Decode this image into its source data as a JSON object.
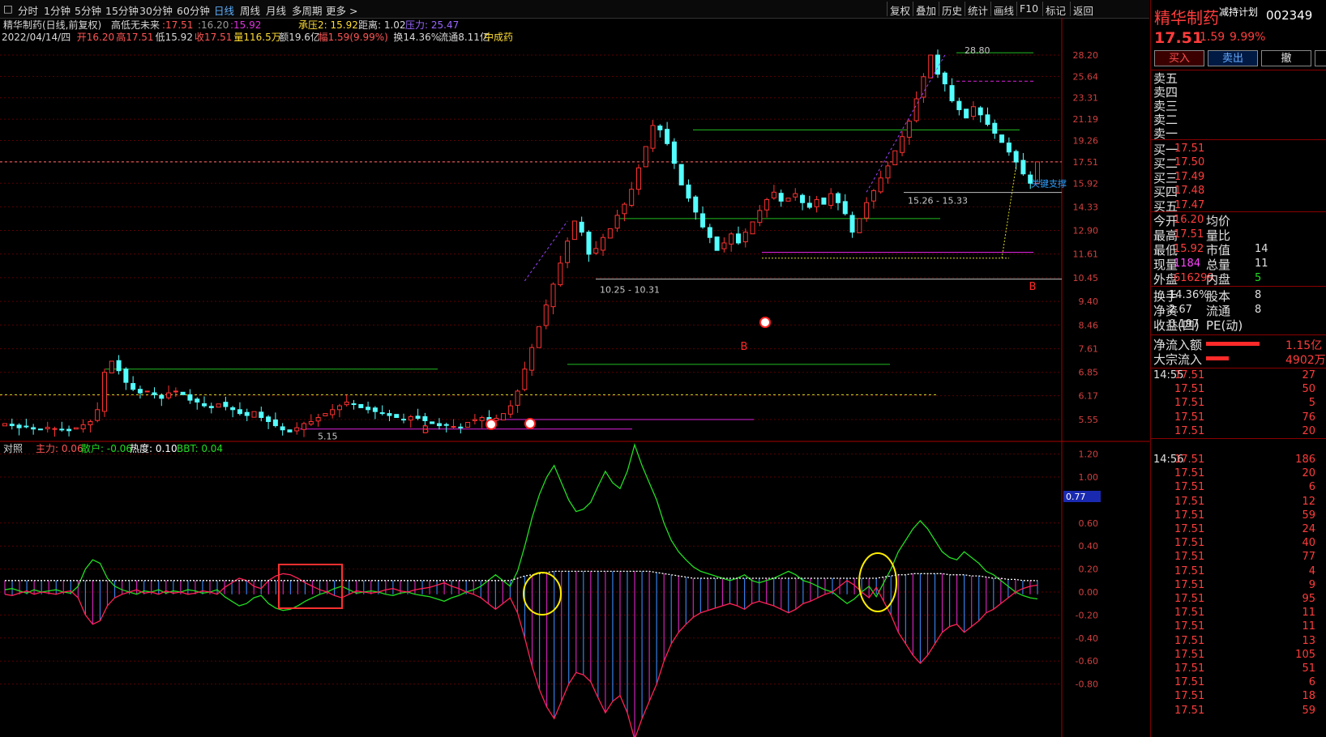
{
  "toolbar": {
    "periods": [
      "分时",
      "1分钟",
      "5分钟",
      "15分钟",
      "30分钟",
      "60分钟",
      "日线",
      "周线",
      "月线",
      "多周期",
      "更多 >"
    ],
    "active": "日线",
    "right": [
      "复权",
      "叠加",
      "历史",
      "统计",
      "画线",
      "F10",
      "标记",
      "返回"
    ]
  },
  "header": {
    "title": "精华制药(日线,前复权)",
    "indicator_name": "高低无未来",
    "indicator_values": [
      ":17.51",
      ":16.20",
      ":15.92"
    ],
    "pressure_label": "承压2: 15.92",
    "distance_label": "距离: 1.02",
    "resist_label": "压力: 25.47",
    "date": "2022/04/14/四",
    "open": "开16.20",
    "high": "高17.51",
    "low": "低15.92",
    "close": "收17.51",
    "volume": "量116.5万",
    "amount": "额19.6亿",
    "change": "幅1.59(9.99%)",
    "turnover": "换14.36%",
    "float": "流通8.11亿",
    "industry": "中成药"
  },
  "lower_header": {
    "name": "对照",
    "main": "主力: 0.06",
    "retail": "散户: -0.06",
    "heat": "热度: 0.10",
    "bbt": "BBT: 0.04"
  },
  "annotations": {
    "peak": "28.80",
    "low_mark": "5.15",
    "zone1": "10.25 - 10.31",
    "zone2": "15.26 - 15.33",
    "key_support": "关键支撑",
    "buy_marker": "B",
    "current_box": "0.77"
  },
  "side": {
    "name": "精华制药",
    "tag": "减持计划",
    "code": "002349",
    "price": "17.51",
    "change": "1.59",
    "pct": "9.99%",
    "buttons": [
      "买入",
      "卖出",
      "撤",
      ""
    ],
    "sells": [
      "卖五",
      "卖四",
      "卖三",
      "卖二",
      "卖一"
    ],
    "buys": [
      {
        "label": "买一",
        "price": "17.51"
      },
      {
        "label": "买二",
        "price": "17.50"
      },
      {
        "label": "买三",
        "price": "17.49"
      },
      {
        "label": "买四",
        "price": "17.48"
      },
      {
        "label": "买五",
        "price": "17.47"
      }
    ],
    "stats": [
      {
        "l1": "今开",
        "v1": "16.20",
        "l2": "均价",
        "v2": ""
      },
      {
        "l1": "最高",
        "v1": "17.51",
        "l2": "量比",
        "v2": ""
      },
      {
        "l1": "最低",
        "v1": "15.92",
        "l2": "市值",
        "v2": "14"
      },
      {
        "l1": "现量",
        "v1": "1184",
        "l2": "总量",
        "v2": "11"
      },
      {
        "l1": "外盘",
        "v1": "616299",
        "l2": "内盘",
        "v2": "5"
      }
    ],
    "stats2": [
      {
        "l1": "换手",
        "v1": "14.36%",
        "l2": "股本",
        "v2": "8"
      },
      {
        "l1": "净资",
        "v1": "2.67",
        "l2": "流通",
        "v2": "8"
      },
      {
        "l1": "收益(四)",
        "v1": "0.197",
        "l2": "PE(动)",
        "v2": ""
      }
    ],
    "flows": [
      {
        "label": "净流入额",
        "value": "1.15亿"
      },
      {
        "label": "大宗流入",
        "value": "4902万"
      }
    ],
    "ticks": [
      {
        "time": "14:55",
        "price": "17.51",
        "vol": "27"
      },
      {
        "time": "",
        "price": "17.51",
        "vol": "50"
      },
      {
        "time": "",
        "price": "17.51",
        "vol": "5"
      },
      {
        "time": "",
        "price": "17.51",
        "vol": "76"
      },
      {
        "time": "",
        "price": "17.51",
        "vol": "20"
      },
      {
        "time": "14:56",
        "price": "17.51",
        "vol": "186"
      },
      {
        "time": "",
        "price": "17.51",
        "vol": "20"
      },
      {
        "time": "",
        "price": "17.51",
        "vol": "6"
      },
      {
        "time": "",
        "price": "17.51",
        "vol": "12"
      },
      {
        "time": "",
        "price": "17.51",
        "vol": "59"
      },
      {
        "time": "",
        "price": "17.51",
        "vol": "24"
      },
      {
        "time": "",
        "price": "17.51",
        "vol": "40"
      },
      {
        "time": "",
        "price": "17.51",
        "vol": "77"
      },
      {
        "time": "",
        "price": "17.51",
        "vol": "4"
      },
      {
        "time": "",
        "price": "17.51",
        "vol": "9"
      },
      {
        "time": "",
        "price": "17.51",
        "vol": "95"
      },
      {
        "time": "",
        "price": "17.51",
        "vol": "11"
      },
      {
        "time": "",
        "price": "17.51",
        "vol": "11"
      },
      {
        "time": "",
        "price": "17.51",
        "vol": "13"
      },
      {
        "time": "",
        "price": "17.51",
        "vol": "105"
      },
      {
        "time": "",
        "price": "17.51",
        "vol": "51"
      },
      {
        "time": "",
        "price": "17.51",
        "vol": "6"
      },
      {
        "time": "",
        "price": "17.51",
        "vol": "18"
      },
      {
        "time": "",
        "price": "17.51",
        "vol": "59"
      }
    ]
  },
  "colors": {
    "up": "#ff3232",
    "down": "#54ffff",
    "green_line": "#22cc22",
    "magenta": "#dd22dd",
    "yellow": "#ffd700"
  },
  "chart_data": [
    {
      "type": "candlestick",
      "scale": "log",
      "y_ticks": [
        28.2,
        25.64,
        23.31,
        21.19,
        19.26,
        17.51,
        15.92,
        14.33,
        12.9,
        11.61,
        10.45,
        9.4,
        8.46,
        7.61,
        6.85,
        6.17,
        5.55
      ],
      "ylim": [
        5.0,
        29.5
      ],
      "last_close": 17.51,
      "closes": [
        5.45,
        5.4,
        5.35,
        5.38,
        5.32,
        5.3,
        5.36,
        5.33,
        5.3,
        5.28,
        5.35,
        5.42,
        5.5,
        5.8,
        6.85,
        7.2,
        6.9,
        6.55,
        6.35,
        6.25,
        6.3,
        6.2,
        6.1,
        6.25,
        6.3,
        6.2,
        6.05,
        6.0,
        5.9,
        5.85,
        5.95,
        5.88,
        5.8,
        5.7,
        5.65,
        5.75,
        5.6,
        5.5,
        5.4,
        5.3,
        5.25,
        5.35,
        5.45,
        5.5,
        5.6,
        5.7,
        5.8,
        5.9,
        6.0,
        5.95,
        5.85,
        5.8,
        5.75,
        5.7,
        5.65,
        5.6,
        5.55,
        5.62,
        5.58,
        5.52,
        5.45,
        5.4,
        5.42,
        5.38,
        5.35,
        5.48,
        5.55,
        5.6,
        5.5,
        5.58,
        5.7,
        5.9,
        6.3,
        6.95,
        7.65,
        8.4,
        9.25,
        10.15,
        11.15,
        12.3,
        13.45,
        12.8,
        11.6,
        11.9,
        12.5,
        13.0,
        13.8,
        14.5,
        15.5,
        17.05,
        18.75,
        20.6,
        20.2,
        19.0,
        17.4,
        15.8,
        14.9,
        14.0,
        13.1,
        12.5,
        11.8,
        12.2,
        12.7,
        12.2,
        12.8,
        13.4,
        14.1,
        14.8,
        15.3,
        14.7,
        14.9,
        15.2,
        14.6,
        14.3,
        14.8,
        14.5,
        15.2,
        14.6,
        13.9,
        12.8,
        13.6,
        14.6,
        15.4,
        16.3,
        17.2,
        18.4,
        19.6,
        21.0,
        23.2,
        25.6,
        28.2,
        25.9,
        24.8,
        23.0,
        22.1,
        21.3,
        22.4,
        21.6,
        20.7,
        19.9,
        19.1,
        18.3,
        17.5,
        16.6,
        15.92,
        17.51
      ]
    },
    {
      "type": "line",
      "title": "对照",
      "ylim": [
        -1.0,
        1.3
      ],
      "y_ticks": [
        1.2,
        1.0,
        0.6,
        0.4,
        0.2,
        0.0,
        -0.2,
        -0.4,
        -0.6,
        -0.8
      ],
      "series": [
        {
          "name": "主力",
          "values": [
            0.02,
            0.03,
            0.01,
            -0.01,
            0.02,
            0.0,
            0.01,
            0.02,
            0.0,
            -0.01,
            0.05,
            0.2,
            0.28,
            0.25,
            0.12,
            0.05,
            0.02,
            0.0,
            -0.02,
            0.01,
            0.0,
            0.02,
            -0.01,
            0.01,
            0.0,
            0.02,
            0.01,
            -0.01,
            0.0,
            0.02,
            -0.04,
            -0.08,
            -0.12,
            -0.1,
            -0.05,
            -0.03,
            -0.1,
            -0.14,
            -0.16,
            -0.15,
            -0.12,
            -0.08,
            -0.05,
            -0.02,
            0.0,
            0.03,
            0.05,
            0.02,
            -0.01,
            0.0,
            0.01,
            0.0,
            -0.02,
            -0.03,
            -0.01,
            0.0,
            -0.02,
            -0.03,
            -0.04,
            -0.06,
            -0.08,
            -0.05,
            -0.03,
            0.0,
            0.02,
            0.05,
            0.1,
            0.15,
            0.1,
            0.05,
            0.18,
            0.4,
            0.65,
            0.85,
            1.0,
            1.1,
            0.95,
            0.8,
            0.7,
            0.72,
            0.78,
            0.92,
            1.05,
            0.95,
            0.9,
            1.05,
            1.28,
            1.1,
            0.95,
            0.8,
            0.6,
            0.45,
            0.35,
            0.28,
            0.22,
            0.18,
            0.16,
            0.14,
            0.12,
            0.1,
            0.12,
            0.15,
            0.1,
            0.08,
            0.1,
            0.12,
            0.15,
            0.18,
            0.15,
            0.1,
            0.08,
            0.05,
            0.02,
            0.0,
            -0.05,
            -0.1,
            -0.06,
            0.0,
            0.05,
            -0.04,
            0.08,
            0.2,
            0.35,
            0.45,
            0.55,
            0.62,
            0.55,
            0.45,
            0.35,
            0.3,
            0.28,
            0.35,
            0.3,
            0.25,
            0.18,
            0.15,
            0.1,
            0.05,
            0.0,
            -0.03,
            -0.05,
            -0.06
          ]
        },
        {
          "name": "散户",
          "values": [
            -0.02,
            -0.03,
            -0.01,
            0.01,
            -0.02,
            0.0,
            -0.01,
            -0.02,
            0.0,
            0.01,
            -0.05,
            -0.2,
            -0.28,
            -0.25,
            -0.12,
            -0.05,
            -0.02,
            0.0,
            0.02,
            -0.01,
            0.0,
            -0.02,
            0.01,
            -0.01,
            0.0,
            -0.02,
            -0.01,
            0.01,
            0.0,
            -0.02,
            0.04,
            0.08,
            0.12,
            0.1,
            0.05,
            0.03,
            0.1,
            0.14,
            0.16,
            0.15,
            0.12,
            0.08,
            0.05,
            0.02,
            0.0,
            -0.03,
            -0.05,
            -0.02,
            0.01,
            0.0,
            -0.01,
            0.0,
            0.02,
            0.03,
            0.01,
            0.0,
            0.02,
            0.03,
            0.04,
            0.06,
            0.08,
            0.05,
            0.03,
            0.0,
            -0.02,
            -0.05,
            -0.1,
            -0.15,
            -0.1,
            -0.05,
            -0.18,
            -0.4,
            -0.65,
            -0.85,
            -1.0,
            -1.1,
            -0.95,
            -0.8,
            -0.7,
            -0.72,
            -0.78,
            -0.92,
            -1.05,
            -0.95,
            -0.9,
            -1.05,
            -1.28,
            -1.1,
            -0.95,
            -0.8,
            -0.6,
            -0.45,
            -0.35,
            -0.28,
            -0.22,
            -0.18,
            -0.16,
            -0.14,
            -0.12,
            -0.1,
            -0.12,
            -0.15,
            -0.1,
            -0.08,
            -0.1,
            -0.12,
            -0.15,
            -0.18,
            -0.15,
            -0.1,
            -0.08,
            -0.05,
            -0.02,
            0.0,
            0.05,
            0.1,
            0.06,
            0.0,
            -0.05,
            0.04,
            -0.08,
            -0.2,
            -0.35,
            -0.45,
            -0.55,
            -0.62,
            -0.55,
            -0.45,
            -0.35,
            -0.3,
            -0.28,
            -0.35,
            -0.3,
            -0.25,
            -0.18,
            -0.15,
            -0.1,
            -0.05,
            0.0,
            0.03,
            0.05,
            0.06
          ]
        },
        {
          "name": "热度",
          "values": [
            0.1,
            0.1,
            0.1,
            0.1,
            0.1,
            0.1,
            0.1,
            0.1,
            0.1,
            0.1,
            0.1,
            0.1,
            0.1,
            0.1,
            0.1,
            0.1,
            0.1,
            0.1,
            0.1,
            0.1,
            0.1,
            0.1,
            0.1,
            0.1,
            0.1,
            0.1,
            0.1,
            0.1,
            0.1,
            0.1,
            0.1,
            0.1,
            0.1,
            0.1,
            0.1,
            0.1,
            0.1,
            0.1,
            0.1,
            0.1,
            0.1,
            0.1,
            0.1,
            0.1,
            0.1,
            0.1,
            0.1,
            0.1,
            0.1,
            0.1,
            0.1,
            0.1,
            0.1,
            0.1,
            0.1,
            0.1,
            0.1,
            0.1,
            0.1,
            0.1,
            0.1,
            0.1,
            0.1,
            0.1,
            0.1,
            0.1,
            0.1,
            0.1,
            0.1,
            0.1,
            0.12,
            0.14,
            0.15,
            0.16,
            0.17,
            0.18,
            0.18,
            0.18,
            0.18,
            0.18,
            0.18,
            0.18,
            0.18,
            0.18,
            0.18,
            0.18,
            0.18,
            0.18,
            0.18,
            0.17,
            0.16,
            0.15,
            0.14,
            0.13,
            0.12,
            0.12,
            0.12,
            0.12,
            0.12,
            0.12,
            0.12,
            0.12,
            0.12,
            0.12,
            0.12,
            0.12,
            0.12,
            0.12,
            0.12,
            0.12,
            0.12,
            0.12,
            0.12,
            0.12,
            0.12,
            0.12,
            0.12,
            0.12,
            0.12,
            0.12,
            0.13,
            0.14,
            0.15,
            0.15,
            0.16,
            0.16,
            0.16,
            0.16,
            0.16,
            0.15,
            0.15,
            0.15,
            0.14,
            0.14,
            0.13,
            0.12,
            0.12,
            0.11,
            0.11,
            0.1,
            0.1,
            0.1
          ]
        }
      ]
    }
  ]
}
